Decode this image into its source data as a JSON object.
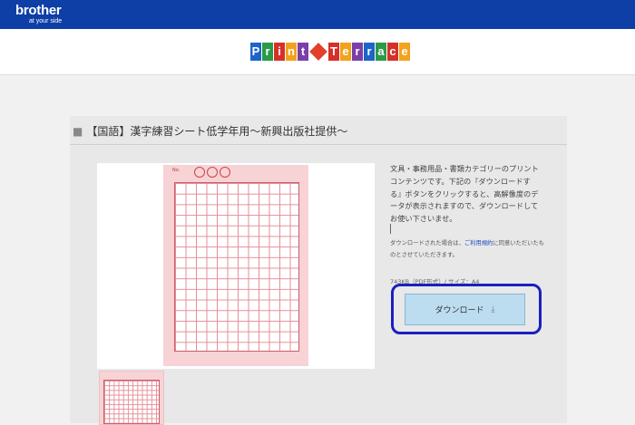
{
  "header": {
    "brand": "brother",
    "tagline": "at your side",
    "brand_color": "#0d3fa6"
  },
  "logo": {
    "word1": [
      "P",
      "r",
      "i",
      "n",
      "t"
    ],
    "word2": [
      "T",
      "e",
      "r",
      "r",
      "a",
      "c",
      "e"
    ],
    "colors": [
      "#1e64c8",
      "#2a9b48",
      "#d6302a",
      "#f2a21c",
      "#7b3fa8"
    ]
  },
  "content": {
    "title": "【国語】漢字練習シート低学年用～新興出版社提供～",
    "description": "文具・事務用品・書類カテゴリーのプリントコンテンツです。下記の『ダウンロードする』ボタンをクリックすると、高解像度のデータが表示されますので、ダウンロードしてお使い下さいませ。",
    "note_prefix": "ダウンロードされた場合は、",
    "note_link": "ご利用規約",
    "note_suffix": "に同意いただいたものとさせていただきます。",
    "file_meta": "743KB（PDF形式）/ サイズ：A4",
    "download_label": "ダウンロード",
    "download_icon": "download-tray-icon"
  },
  "sheet": {
    "no_label": "No."
  }
}
